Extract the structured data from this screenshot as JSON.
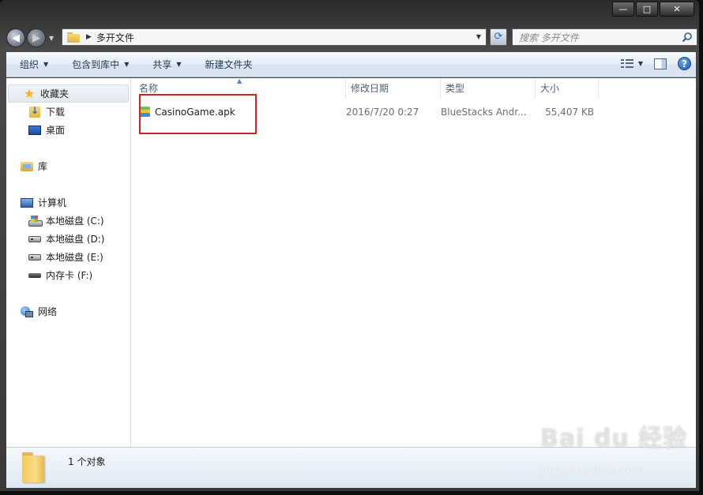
{
  "window": {
    "minimize": "—",
    "maximize": "□",
    "close": "✕"
  },
  "address": {
    "path": "多开文件",
    "search_placeholder": "搜索 多开文件"
  },
  "toolbar": {
    "organize": "组织",
    "include_in_library": "包含到库中",
    "share": "共享",
    "new_folder": "新建文件夹"
  },
  "sidebar": {
    "favorites": "收藏夹",
    "downloads": "下载",
    "desktop": "桌面",
    "libraries": "库",
    "computer": "计算机",
    "drive_c": "本地磁盘 (C:)",
    "drive_d": "本地磁盘 (D:)",
    "drive_e": "本地磁盘 (E:)",
    "card_f": "内存卡 (F:)",
    "network": "网络"
  },
  "columns": {
    "name": "名称",
    "date": "修改日期",
    "type": "类型",
    "size": "大小"
  },
  "files": [
    {
      "name": "CasinoGame.apk",
      "date": "2016/7/20 0:27",
      "type": "BlueStacks Andr...",
      "size": "55,407 KB"
    }
  ],
  "status": {
    "count": "1 个对象"
  },
  "watermark": {
    "main": "Bai du 经验",
    "sub": "jingyan.baidu.com"
  },
  "colors": {
    "highlight_box": "#d0231f",
    "toolbar_text": "#1e395b"
  }
}
